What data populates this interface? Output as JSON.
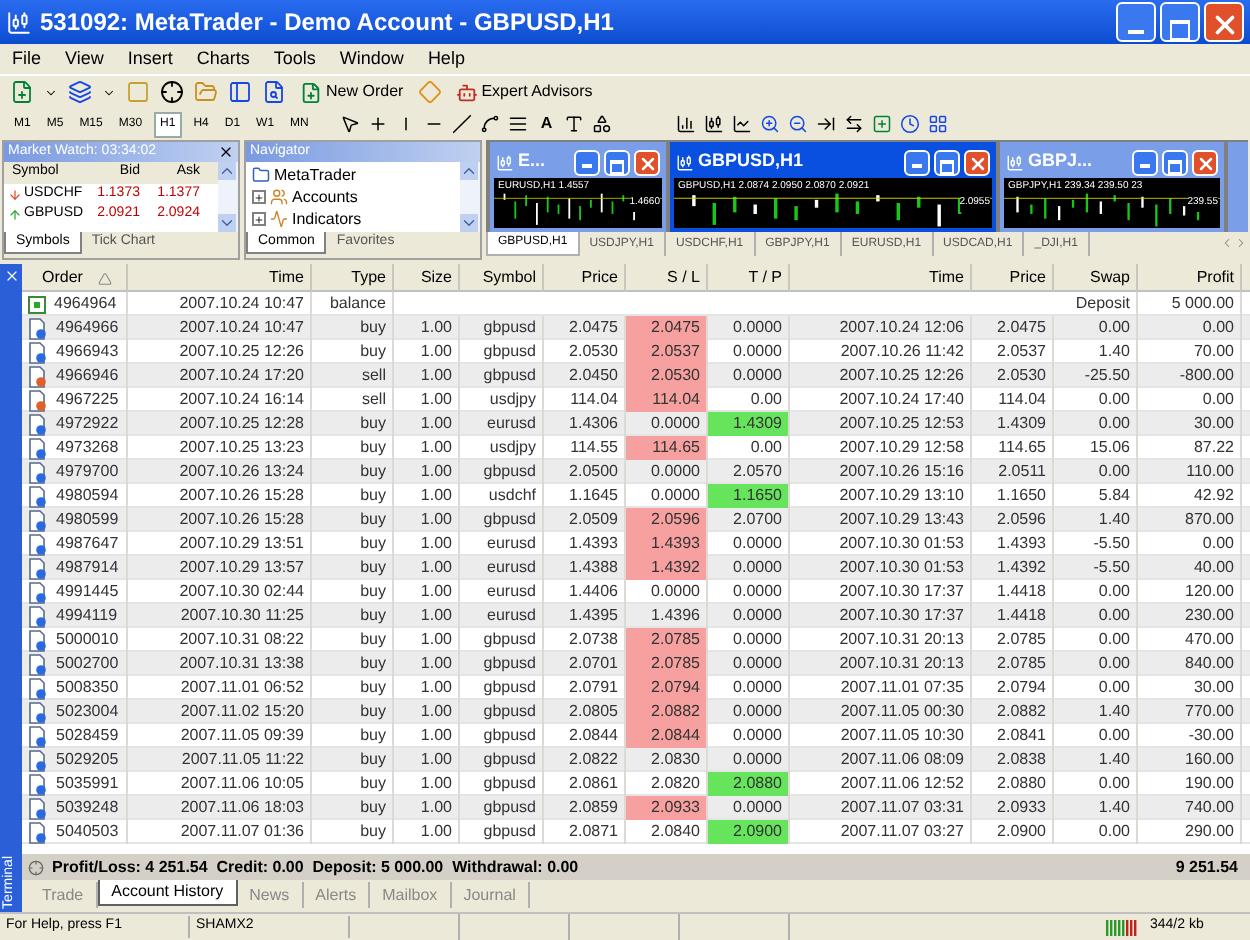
{
  "window": {
    "title": "531092: MetaTrader - Demo Account - GBPUSD,H1"
  },
  "menu": [
    "File",
    "View",
    "Insert",
    "Charts",
    "Tools",
    "Window",
    "Help"
  ],
  "toolbar": {
    "buttons": [
      "New Order",
      "Expert Advisors"
    ],
    "text_tool": "A"
  },
  "timeframes": [
    {
      "label": "M1",
      "selected": false
    },
    {
      "label": "M5",
      "selected": false
    },
    {
      "label": "M15",
      "selected": false
    },
    {
      "label": "M30",
      "selected": false
    },
    {
      "label": "H1",
      "selected": true
    },
    {
      "label": "H4",
      "selected": false
    },
    {
      "label": "D1",
      "selected": false
    },
    {
      "label": "W1",
      "selected": false
    },
    {
      "label": "MN",
      "selected": false
    }
  ],
  "market_watch": {
    "title": "Market Watch: 03:34:02",
    "columns": [
      "Symbol",
      "Bid",
      "Ask"
    ],
    "rows": [
      {
        "symbol": "USDCHF",
        "bid": "1.1373",
        "ask": "1.1377",
        "kind": "down"
      },
      {
        "symbol": "GBPUSD",
        "bid": "2.0921",
        "ask": "2.0924",
        "kind": "up"
      }
    ],
    "tabs": [
      {
        "label": "Symbols",
        "selected": true
      },
      {
        "label": "Tick Chart",
        "selected": false
      }
    ]
  },
  "navigator": {
    "title": "Navigator",
    "tree": [
      {
        "label": "MetaTrader",
        "expanded": true,
        "children": [
          {
            "label": "Accounts",
            "expanded": false
          },
          {
            "label": "Indicators",
            "expanded": false
          }
        ]
      }
    ],
    "tabs": [
      {
        "label": "Common",
        "selected": true
      },
      {
        "label": "Favorites",
        "selected": false
      }
    ]
  },
  "chart_windows": [
    {
      "title": "E...",
      "active": false,
      "info": "EURUSD,H1 1.4557",
      "price": "1.4660"
    },
    {
      "title": "GBPUSD,H1",
      "active": true,
      "info": "GBPUSD,H1  2.0874 2.0950 2.0870 2.0921",
      "price": "2.0955"
    },
    {
      "title": "GBPJ...",
      "active": false,
      "info": "GBPJPY,H1  239.34 239.50 23",
      "price": "239.55"
    }
  ],
  "chart_tabs": [
    {
      "label": "GBPUSD,H1",
      "selected": true
    },
    {
      "label": "USDJPY,H1",
      "selected": false
    },
    {
      "label": "USDCHF,H1",
      "selected": false
    },
    {
      "label": "GBPJPY,H1",
      "selected": false
    },
    {
      "label": "EURUSD,H1",
      "selected": false
    },
    {
      "label": "USDCAD,H1",
      "selected": false
    },
    {
      "label": "_DJI,H1",
      "selected": false
    }
  ],
  "terminal": {
    "label": "Terminal",
    "columns": [
      "Order",
      "Time",
      "Type",
      "Size",
      "Symbol",
      "Price",
      "S / L",
      "T / P",
      "Time",
      "Price",
      "Swap",
      "Profit"
    ],
    "rows": [
      {
        "kind": "balance",
        "order": "4964964",
        "time": "2007.10.24 10:47",
        "type": "balance",
        "comment": "Deposit",
        "profit": "5 000.00"
      },
      {
        "kind": "buy",
        "order": "4964966",
        "time": "2007.10.24 10:47",
        "type": "buy",
        "size": "1.00",
        "symbol": "gbpusd",
        "price": "2.0475",
        "sl": "2.0475",
        "sl_hit": true,
        "tp": "0.0000",
        "tp_hit": false,
        "close_time": "2007.10.24 12:06",
        "close_price": "2.0475",
        "swap": "0.00",
        "profit": "0.00"
      },
      {
        "kind": "buy",
        "order": "4966943",
        "time": "2007.10.25 12:26",
        "type": "buy",
        "size": "1.00",
        "symbol": "gbpusd",
        "price": "2.0530",
        "sl": "2.0537",
        "sl_hit": true,
        "tp": "0.0000",
        "tp_hit": false,
        "close_time": "2007.10.26 11:42",
        "close_price": "2.0537",
        "swap": "1.40",
        "profit": "70.00"
      },
      {
        "kind": "sell",
        "order": "4966946",
        "time": "2007.10.24 17:20",
        "type": "sell",
        "size": "1.00",
        "symbol": "gbpusd",
        "price": "2.0450",
        "sl": "2.0530",
        "sl_hit": true,
        "tp": "0.0000",
        "tp_hit": false,
        "close_time": "2007.10.25 12:26",
        "close_price": "2.0530",
        "swap": "-25.50",
        "profit": "-800.00"
      },
      {
        "kind": "sell",
        "order": "4967225",
        "time": "2007.10.24 16:14",
        "type": "sell",
        "size": "1.00",
        "symbol": "usdjpy",
        "price": "114.04",
        "sl": "114.04",
        "sl_hit": true,
        "tp": "0.00",
        "tp_hit": false,
        "close_time": "2007.10.24 17:40",
        "close_price": "114.04",
        "swap": "0.00",
        "profit": "0.00"
      },
      {
        "kind": "buy",
        "order": "4972922",
        "time": "2007.10.25 12:28",
        "type": "buy",
        "size": "1.00",
        "symbol": "eurusd",
        "price": "1.4306",
        "sl": "0.0000",
        "sl_hit": false,
        "tp": "1.4309",
        "tp_hit": true,
        "close_time": "2007.10.25 12:53",
        "close_price": "1.4309",
        "swap": "0.00",
        "profit": "30.00"
      },
      {
        "kind": "buy",
        "order": "4973268",
        "time": "2007.10.25 13:23",
        "type": "buy",
        "size": "1.00",
        "symbol": "usdjpy",
        "price": "114.55",
        "sl": "114.65",
        "sl_hit": true,
        "tp": "0.00",
        "tp_hit": false,
        "close_time": "2007.10.29 12:58",
        "close_price": "114.65",
        "swap": "15.06",
        "profit": "87.22"
      },
      {
        "kind": "buy",
        "order": "4979700",
        "time": "2007.10.26 13:24",
        "type": "buy",
        "size": "1.00",
        "symbol": "gbpusd",
        "price": "2.0500",
        "sl": "0.0000",
        "sl_hit": false,
        "tp": "2.0570",
        "tp_hit": false,
        "close_time": "2007.10.26 15:16",
        "close_price": "2.0511",
        "swap": "0.00",
        "profit": "110.00"
      },
      {
        "kind": "buy",
        "order": "4980594",
        "time": "2007.10.26 15:28",
        "type": "buy",
        "size": "1.00",
        "symbol": "usdchf",
        "price": "1.1645",
        "sl": "0.0000",
        "sl_hit": false,
        "tp": "1.1650",
        "tp_hit": true,
        "close_time": "2007.10.29 13:10",
        "close_price": "1.1650",
        "swap": "5.84",
        "profit": "42.92"
      },
      {
        "kind": "buy",
        "order": "4980599",
        "time": "2007.10.26 15:28",
        "type": "buy",
        "size": "1.00",
        "symbol": "gbpusd",
        "price": "2.0509",
        "sl": "2.0596",
        "sl_hit": true,
        "tp": "2.0700",
        "tp_hit": false,
        "close_time": "2007.10.29 13:43",
        "close_price": "2.0596",
        "swap": "1.40",
        "profit": "870.00"
      },
      {
        "kind": "buy",
        "order": "4987647",
        "time": "2007.10.29 13:51",
        "type": "buy",
        "size": "1.00",
        "symbol": "eurusd",
        "price": "1.4393",
        "sl": "1.4393",
        "sl_hit": true,
        "tp": "0.0000",
        "tp_hit": false,
        "close_time": "2007.10.30 01:53",
        "close_price": "1.4393",
        "swap": "-5.50",
        "profit": "0.00"
      },
      {
        "kind": "buy",
        "order": "4987914",
        "time": "2007.10.29 13:57",
        "type": "buy",
        "size": "1.00",
        "symbol": "eurusd",
        "price": "1.4388",
        "sl": "1.4392",
        "sl_hit": true,
        "tp": "0.0000",
        "tp_hit": false,
        "close_time": "2007.10.30 01:53",
        "close_price": "1.4392",
        "swap": "-5.50",
        "profit": "40.00"
      },
      {
        "kind": "buy",
        "order": "4991445",
        "time": "2007.10.30 02:44",
        "type": "buy",
        "size": "1.00",
        "symbol": "eurusd",
        "price": "1.4406",
        "sl": "0.0000",
        "sl_hit": false,
        "tp": "0.0000",
        "tp_hit": false,
        "close_time": "2007.10.30 17:37",
        "close_price": "1.4418",
        "swap": "0.00",
        "profit": "120.00"
      },
      {
        "kind": "buy",
        "order": "4994119",
        "time": "2007.10.30 11:25",
        "type": "buy",
        "size": "1.00",
        "symbol": "eurusd",
        "price": "1.4395",
        "sl": "1.4396",
        "sl_hit": false,
        "tp": "0.0000",
        "tp_hit": false,
        "close_time": "2007.10.30 17:37",
        "close_price": "1.4418",
        "swap": "0.00",
        "profit": "230.00"
      },
      {
        "kind": "buy",
        "order": "5000010",
        "time": "2007.10.31 08:22",
        "type": "buy",
        "size": "1.00",
        "symbol": "gbpusd",
        "price": "2.0738",
        "sl": "2.0785",
        "sl_hit": true,
        "tp": "0.0000",
        "tp_hit": false,
        "close_time": "2007.10.31 20:13",
        "close_price": "2.0785",
        "swap": "0.00",
        "profit": "470.00"
      },
      {
        "kind": "buy",
        "order": "5002700",
        "time": "2007.10.31 13:38",
        "type": "buy",
        "size": "1.00",
        "symbol": "gbpusd",
        "price": "2.0701",
        "sl": "2.0785",
        "sl_hit": true,
        "tp": "0.0000",
        "tp_hit": false,
        "close_time": "2007.10.31 20:13",
        "close_price": "2.0785",
        "swap": "0.00",
        "profit": "840.00"
      },
      {
        "kind": "buy",
        "order": "5008350",
        "time": "2007.11.01 06:52",
        "type": "buy",
        "size": "1.00",
        "symbol": "gbpusd",
        "price": "2.0791",
        "sl": "2.0794",
        "sl_hit": true,
        "tp": "0.0000",
        "tp_hit": false,
        "close_time": "2007.11.01 07:35",
        "close_price": "2.0794",
        "swap": "0.00",
        "profit": "30.00"
      },
      {
        "kind": "buy",
        "order": "5023004",
        "time": "2007.11.02 15:20",
        "type": "buy",
        "size": "1.00",
        "symbol": "gbpusd",
        "price": "2.0805",
        "sl": "2.0882",
        "sl_hit": true,
        "tp": "0.0000",
        "tp_hit": false,
        "close_time": "2007.11.05 00:30",
        "close_price": "2.0882",
        "swap": "1.40",
        "profit": "770.00"
      },
      {
        "kind": "buy",
        "order": "5028459",
        "time": "2007.11.05 09:39",
        "type": "buy",
        "size": "1.00",
        "symbol": "gbpusd",
        "price": "2.0844",
        "sl": "2.0844",
        "sl_hit": true,
        "tp": "0.0000",
        "tp_hit": false,
        "close_time": "2007.11.05 10:30",
        "close_price": "2.0841",
        "swap": "0.00",
        "profit": "-30.00"
      },
      {
        "kind": "buy",
        "order": "5029205",
        "time": "2007.11.05 11:22",
        "type": "buy",
        "size": "1.00",
        "symbol": "gbpusd",
        "price": "2.0822",
        "sl": "2.0830",
        "sl_hit": false,
        "tp": "0.0000",
        "tp_hit": false,
        "close_time": "2007.11.06 08:09",
        "close_price": "2.0838",
        "swap": "1.40",
        "profit": "160.00"
      },
      {
        "kind": "buy",
        "order": "5035991",
        "time": "2007.11.06 10:05",
        "type": "buy",
        "size": "1.00",
        "symbol": "gbpusd",
        "price": "2.0861",
        "sl": "2.0820",
        "sl_hit": false,
        "tp": "2.0880",
        "tp_hit": true,
        "close_time": "2007.11.06 12:52",
        "close_price": "2.0880",
        "swap": "0.00",
        "profit": "190.00"
      },
      {
        "kind": "buy",
        "order": "5039248",
        "time": "2007.11.06 18:03",
        "type": "buy",
        "size": "1.00",
        "symbol": "gbpusd",
        "price": "2.0859",
        "sl": "2.0933",
        "sl_hit": true,
        "tp": "0.0000",
        "tp_hit": false,
        "close_time": "2007.11.07 03:31",
        "close_price": "2.0933",
        "swap": "1.40",
        "profit": "740.00"
      },
      {
        "kind": "buy",
        "order": "5040503",
        "time": "2007.11.07 01:36",
        "type": "buy",
        "size": "1.00",
        "symbol": "gbpusd",
        "price": "2.0871",
        "sl": "2.0840",
        "sl_hit": false,
        "tp": "2.0900",
        "tp_hit": true,
        "close_time": "2007.11.07 03:27",
        "close_price": "2.0900",
        "swap": "0.00",
        "profit": "290.00"
      }
    ],
    "summary": "Profit/Loss: 4 251.54  Credit: 0.00  Deposit: 5 000.00  Withdrawal: 0.00",
    "total": "9 251.54",
    "tabs": [
      {
        "label": "Trade",
        "selected": false
      },
      {
        "label": "Account History",
        "selected": true
      },
      {
        "label": "News",
        "selected": false
      },
      {
        "label": "Alerts",
        "selected": false
      },
      {
        "label": "Mailbox",
        "selected": false
      },
      {
        "label": "Journal",
        "selected": false
      }
    ]
  },
  "status_bar": {
    "help": "For Help, press F1",
    "profile": "SHAMX2",
    "traffic": "344/2 kb"
  }
}
